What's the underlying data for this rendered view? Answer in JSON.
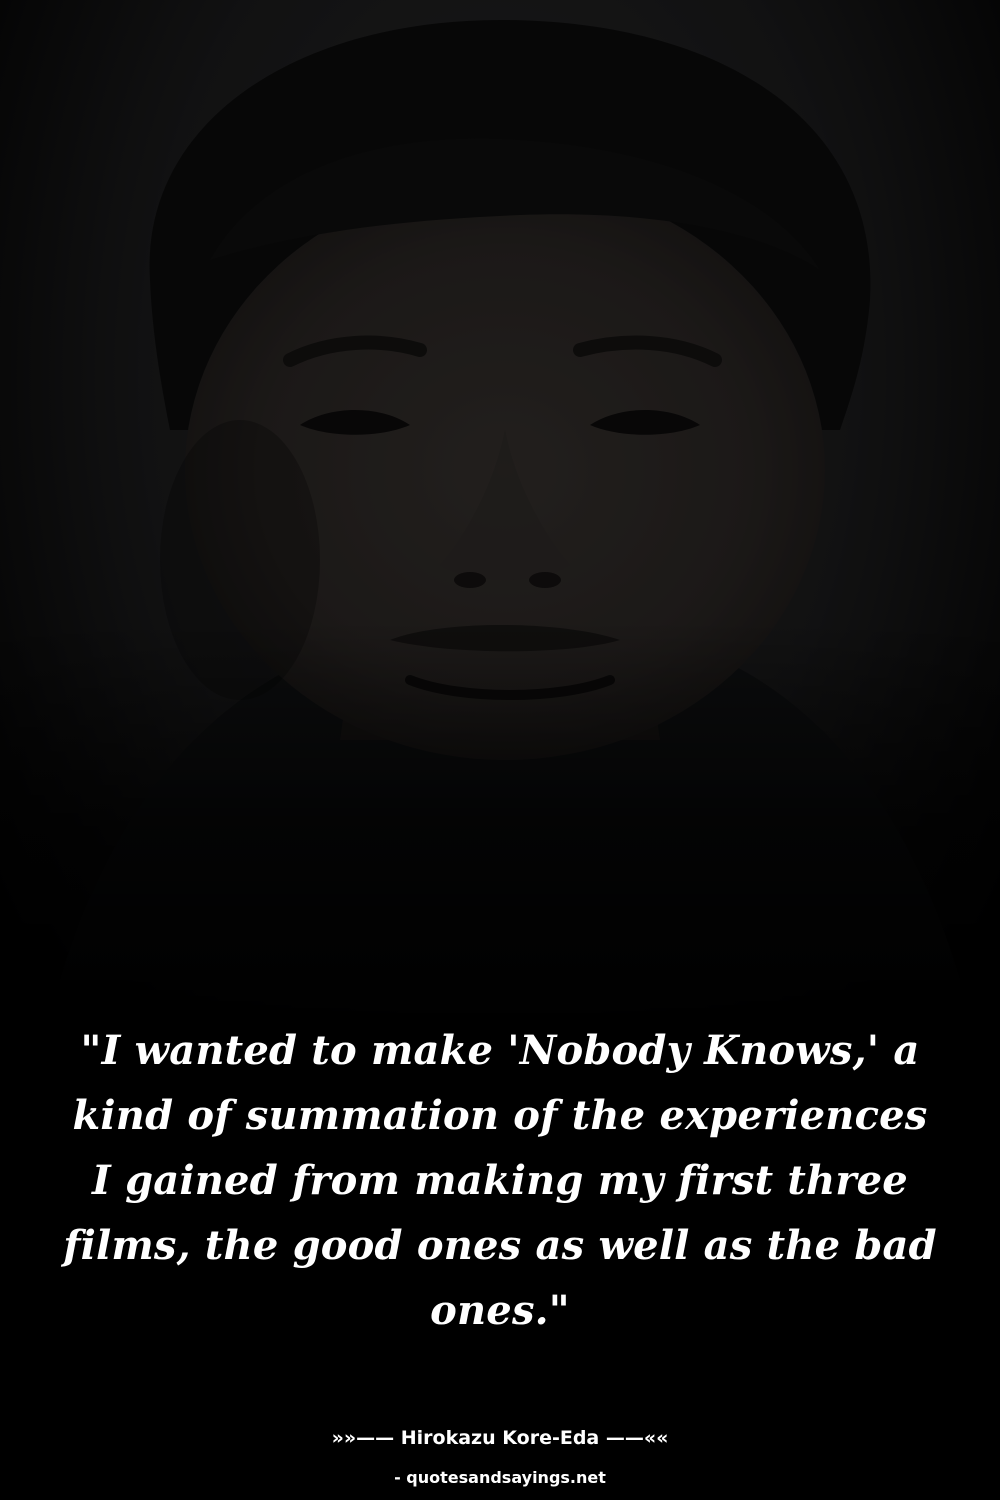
{
  "photo": {
    "icon": "portrait-photo",
    "colors": {
      "background": "#000000",
      "skin": "#2a2624",
      "hair": "#0c0c0c",
      "shirt": "#121314",
      "shadow": "#050505"
    }
  },
  "quote": {
    "text": "\"I wanted to make 'Nobody Knows,' a kind of summation of the experiences I gained from making my first three films, the good ones as well as the bad ones.\""
  },
  "attribution": {
    "text": "»»—— Hirokazu Kore-Eda ——««"
  },
  "source": {
    "text": "- quotesandsayings.net"
  },
  "colors": {
    "text": "#ffffff",
    "background": "#000000"
  }
}
